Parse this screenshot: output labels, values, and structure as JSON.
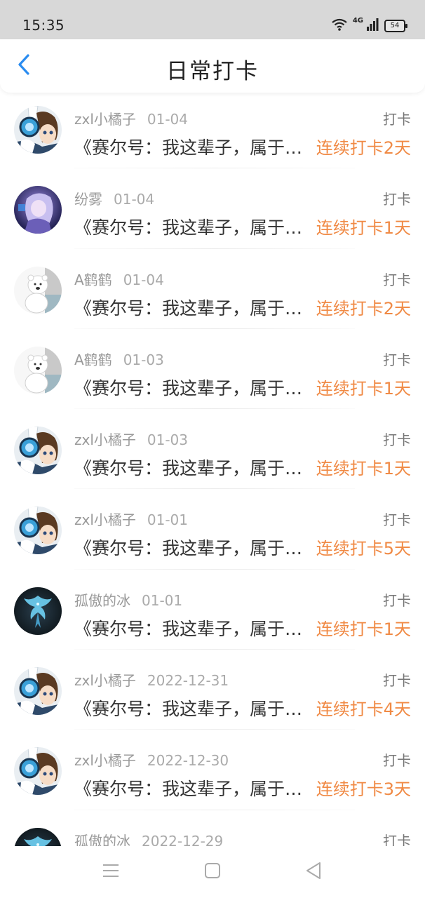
{
  "status_bar": {
    "time": "15:35",
    "network": "4G",
    "battery": "54",
    "icons": [
      "wifi-icon",
      "signal-icon",
      "battery-icon"
    ]
  },
  "header": {
    "title": "日常打卡",
    "back_icon": "chevron-left-icon",
    "accent_color": "#2a8cf0"
  },
  "colors": {
    "streak": "#f08a45",
    "meta": "#9a9a9a"
  },
  "list": {
    "items": [
      {
        "user": "zxl小橘子",
        "date": "01-04",
        "type": "打卡",
        "content": "《赛尔号：我这辈子，属于赛尔号》",
        "streak": "连续打卡2天",
        "avatar": "anime-boy"
      },
      {
        "user": "纷雾",
        "date": "01-04",
        "type": "打卡",
        "content": "《赛尔号：我这辈子，属于赛尔号》",
        "streak": "连续打卡1天",
        "avatar": "purple-girl"
      },
      {
        "user": "A鹤鹤",
        "date": "01-04",
        "type": "打卡",
        "content": "《赛尔号：我这辈子，属于赛尔号》",
        "streak": "连续打卡2天",
        "avatar": "polar-bear"
      },
      {
        "user": "A鹤鹤",
        "date": "01-03",
        "type": "打卡",
        "content": "《赛尔号：我这辈子，属于赛尔号》",
        "streak": "连续打卡1天",
        "avatar": "polar-bear"
      },
      {
        "user": "zxl小橘子",
        "date": "01-03",
        "type": "打卡",
        "content": "《赛尔号：我这辈子，属于赛尔号》",
        "streak": "连续打卡1天",
        "avatar": "anime-boy"
      },
      {
        "user": "zxl小橘子",
        "date": "01-01",
        "type": "打卡",
        "content": "《赛尔号：我这辈子，属于赛尔号》",
        "streak": "连续打卡5天",
        "avatar": "anime-boy"
      },
      {
        "user": "孤傲的冰",
        "date": "01-01",
        "type": "打卡",
        "content": "《赛尔号：我这辈子，属于赛尔号》",
        "streak": "连续打卡1天",
        "avatar": "blue-phoenix"
      },
      {
        "user": "zxl小橘子",
        "date": "2022-12-31",
        "type": "打卡",
        "content": "《赛尔号：我这辈子，属于赛尔号》",
        "streak": "连续打卡4天",
        "avatar": "anime-boy"
      },
      {
        "user": "zxl小橘子",
        "date": "2022-12-30",
        "type": "打卡",
        "content": "《赛尔号：我这辈子，属于赛尔号》",
        "streak": "连续打卡3天",
        "avatar": "anime-boy"
      },
      {
        "user": "孤傲的冰",
        "date": "2022-12-29",
        "type": "打卡",
        "content": "",
        "streak": "",
        "avatar": "blue-phoenix"
      }
    ]
  },
  "nav_bar": {
    "icons": [
      "menu-icon",
      "home-square-icon",
      "back-triangle-icon"
    ]
  }
}
